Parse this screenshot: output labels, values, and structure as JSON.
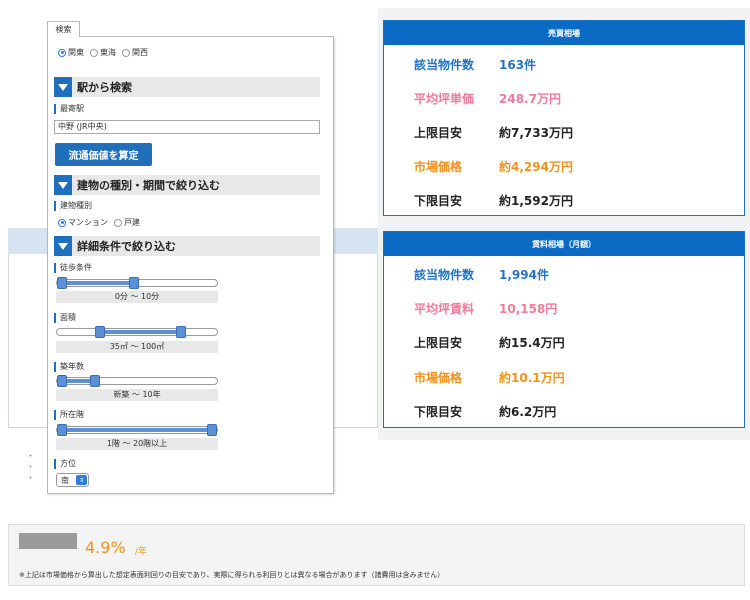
{
  "search_panel": {
    "tab_label": "検索",
    "regions": [
      {
        "label": "関東",
        "selected": true
      },
      {
        "label": "東海",
        "selected": false
      },
      {
        "label": "関西",
        "selected": false
      }
    ],
    "station_section": "駅から検索",
    "nearest_station_label": "最寄駅",
    "station_value": "中野 (JR中央)",
    "calc_button": "流通価値を算定",
    "building_section": "建物の種別・期間で絞り込む",
    "building_type_label": "建物種別",
    "building_types": [
      {
        "label": "マンション",
        "selected": true
      },
      {
        "label": "戸建",
        "selected": false
      }
    ],
    "detail_section": "詳細条件で絞り込む",
    "sliders": [
      {
        "label": "徒歩条件",
        "value": "0分 〜 10分",
        "from": 0.0,
        "to": 0.48
      },
      {
        "label": "面積",
        "value": "35㎡ 〜 100㎡",
        "from": 0.25,
        "to": 0.79
      },
      {
        "label": "築年数",
        "value": "新築 〜 10年",
        "from": 0.0,
        "to": 0.22
      },
      {
        "label": "所在階",
        "value": "1階 〜 20階以上",
        "from": 0.0,
        "to": 1.0
      }
    ],
    "direction_label": "方位",
    "direction_value": "南"
  },
  "sale_card": {
    "title": "売買相場",
    "rows": [
      {
        "label": "該当物件数",
        "value": "163件",
        "color": "#2474c6"
      },
      {
        "label": "平均坪単価",
        "value": "248.7万円",
        "color": "#f27b9a"
      },
      {
        "label": "上限目安",
        "value": "約7,733万円",
        "color": "#222222"
      },
      {
        "label": "市場価格",
        "value": "約4,294万円",
        "color": "#f0921e"
      },
      {
        "label": "下限目安",
        "value": "約1,592万円",
        "color": "#222222"
      }
    ]
  },
  "rent_card": {
    "title": "賃料相場（月額）",
    "rows": [
      {
        "label": "該当物件数",
        "value": "1,994件",
        "color": "#2474c6"
      },
      {
        "label": "平均坪賃料",
        "value": "10,158円",
        "color": "#f27b9a"
      },
      {
        "label": "上限目安",
        "value": "約15.4万円",
        "color": "#222222"
      },
      {
        "label": "市場価格",
        "value": "約10.1万円",
        "color": "#f0921e"
      },
      {
        "label": "下限目安",
        "value": "約6.2万円",
        "color": "#222222"
      }
    ]
  },
  "yield": {
    "value": "4.9%",
    "unit": "/年",
    "note": "※上記は市場価格から算出した想定表面利回りの目安であり、実際に得られる利回りとは異なる場合があります（諸費用は含みません）"
  },
  "colors": {
    "accent_blue": "#1f6fbd",
    "header_blue": "#0b6ac4",
    "orange": "#f0921e",
    "pink": "#f27b9a"
  }
}
